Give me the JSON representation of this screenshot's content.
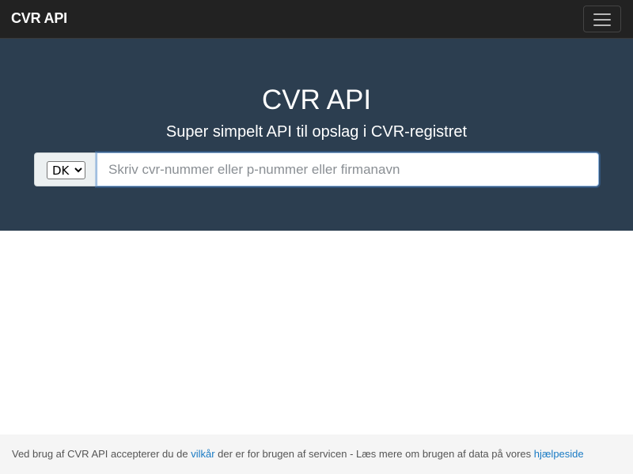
{
  "navbar": {
    "brand": "CVR API",
    "menu_icon": "hamburger-icon"
  },
  "hero": {
    "title": "CVR API",
    "subtitle": "Super simpelt API til opslag i CVR-registret"
  },
  "search": {
    "country_selected": "DK",
    "placeholder": "Skriv cvr-nummer eller p-nummer eller firmanavn",
    "value": ""
  },
  "footer": {
    "text_before": "Ved brug af CVR API accepterer du de ",
    "terms_link": "vilkår",
    "text_middle": " der er for brugen af servicen - Læs mere om brugen af data på vores ",
    "help_link": "hjælpeside"
  },
  "colors": {
    "navbar_bg": "#222222",
    "hero_bg": "#2c3e50",
    "link": "#1a7bc4",
    "footer_bg": "#f5f5f5"
  }
}
